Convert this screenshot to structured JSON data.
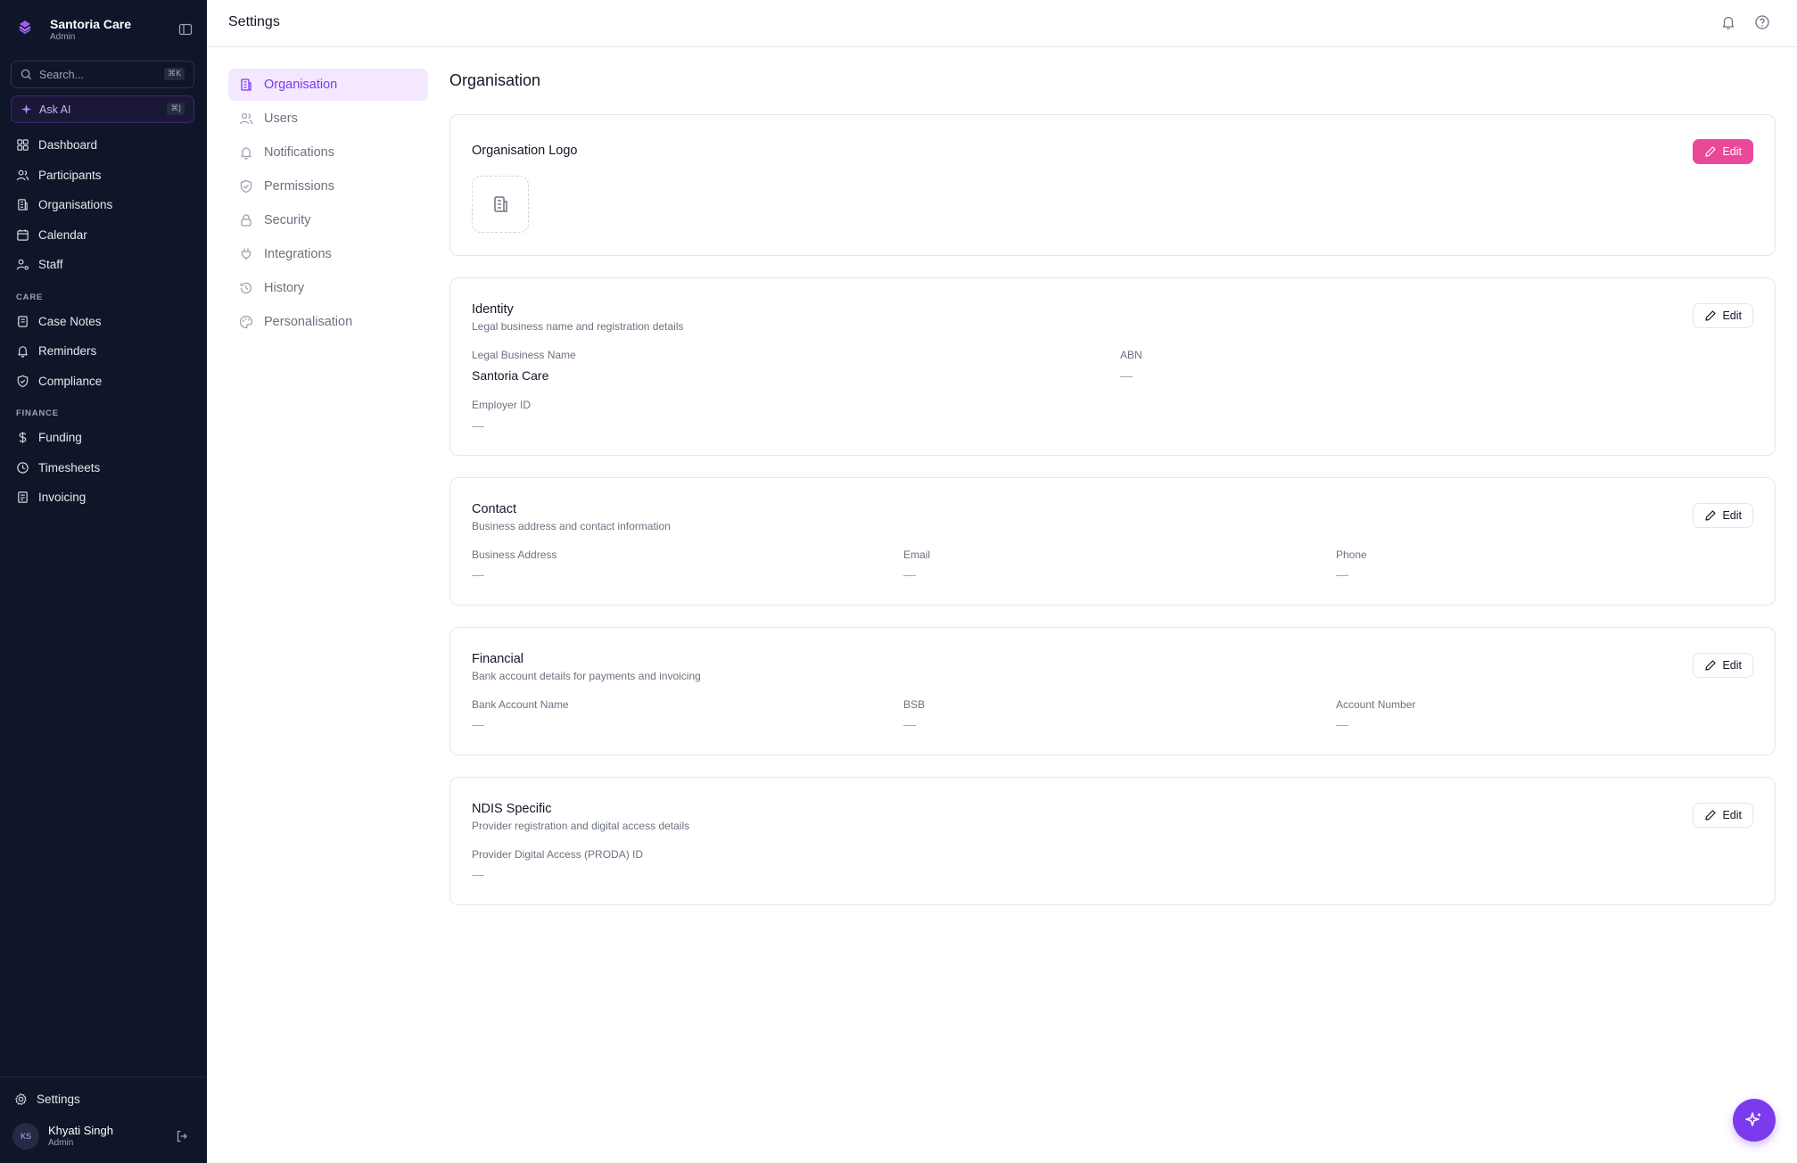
{
  "sidebar": {
    "brand_name": "Santoria Care",
    "brand_role": "Admin",
    "search_placeholder": "Search...",
    "search_shortcut": "⌘K",
    "ask_ai_label": "Ask AI",
    "ask_ai_shortcut": "⌘J",
    "main_items": [
      "Dashboard",
      "Participants",
      "Organisations",
      "Calendar",
      "Staff"
    ],
    "care_label": "CARE",
    "care_items": [
      "Case Notes",
      "Reminders",
      "Compliance"
    ],
    "finance_label": "FINANCE",
    "finance_items": [
      "Funding",
      "Timesheets",
      "Invoicing"
    ],
    "settings_label": "Settings",
    "user_initials": "KS",
    "user_name": "Khyati Singh",
    "user_role": "Admin"
  },
  "topbar": {
    "title": "Settings"
  },
  "settings_nav": [
    "Organisation",
    "Users",
    "Notifications",
    "Permissions",
    "Security",
    "Integrations",
    "History",
    "Personalisation"
  ],
  "content": {
    "section_title": "Organisation",
    "edit_label": "Edit",
    "empty_value": "—",
    "logo_card": {
      "title": "Organisation Logo"
    },
    "identity": {
      "title": "Identity",
      "subtitle": "Legal business name and registration details",
      "legal_name_label": "Legal Business Name",
      "legal_name_value": "Santoria Care",
      "abn_label": "ABN",
      "employer_id_label": "Employer ID"
    },
    "contact": {
      "title": "Contact",
      "subtitle": "Business address and contact information",
      "address_label": "Business Address",
      "email_label": "Email",
      "phone_label": "Phone"
    },
    "financial": {
      "title": "Financial",
      "subtitle": "Bank account details for payments and invoicing",
      "bank_name_label": "Bank Account Name",
      "bsb_label": "BSB",
      "account_number_label": "Account Number"
    },
    "ndis": {
      "title": "NDIS Specific",
      "subtitle": "Provider registration and digital access details",
      "proda_label": "Provider Digital Access (PRODA) ID"
    }
  },
  "colors": {
    "sidebar_bg": "#0f1629",
    "accent": "#7c3aed",
    "primary_edit": "#ec4899"
  }
}
